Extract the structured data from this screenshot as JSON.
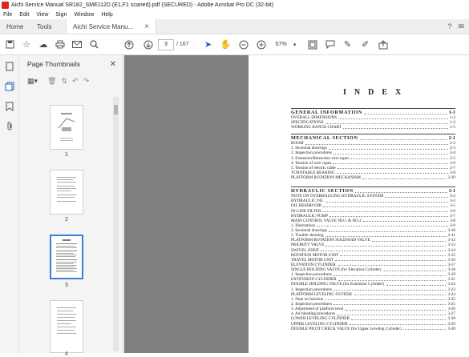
{
  "window": {
    "title": "Aichi Service Manual SR182_SME112D (E1,F1 scaned).pdf (SECURED) - Adobe Acrobat Pro DC (32-bit)"
  },
  "menu": [
    "File",
    "Edit",
    "View",
    "Sign",
    "Window",
    "Help"
  ],
  "tabs": {
    "home": "Home",
    "tools": "Tools",
    "document": "Aichi Service Manu...",
    "close": "×"
  },
  "toolbar": {
    "page_current": "3",
    "page_count": "/ 167",
    "zoom": "57%"
  },
  "thumbnails": {
    "title": "Page Thumbnails",
    "pages": [
      "1",
      "2",
      "3",
      "4"
    ],
    "selected": "3"
  },
  "document": {
    "index_title": "INDEX",
    "sections": [
      {
        "title": "GENERAL   INFORMATION",
        "page": "1-1",
        "items": [
          {
            "t": "OVERALL DIMENSIONS",
            "p": "1-2"
          },
          {
            "t": "SPECIFICATIONS",
            "p": "1-3"
          },
          {
            "t": "WORKING RANGE CHART",
            "p": "1-5"
          }
        ]
      },
      {
        "title": "MECHANICAL   SECTION",
        "page": "2-1",
        "items": [
          {
            "t": "BOOM",
            "p": "2-2"
          },
          {
            "t": "1. Sectional drawings",
            "p": "2-3"
          },
          {
            "t": "2. Inspection procedures",
            "p": "2-4"
          },
          {
            "t": "3. Extension/Retraction wire ropes",
            "p": "2-5"
          },
          {
            "t": "4. Tension of wire ropes",
            "p": "2-6"
          },
          {
            "t": "5. Tension of electric cable",
            "p": "2-7"
          },
          {
            "t": "TURNTABLE BEARING",
            "p": "2-8"
          },
          {
            "t": "PLATFORM ROTATION MECHANISM",
            "p": "2-10"
          }
        ]
      },
      {
        "title": "HYDRAULIC   SECTION",
        "page": "3-1",
        "items": [
          {
            "t": "NOTE ON OVERHAULING HYDRAULIC SYSTEM",
            "p": "3-2"
          },
          {
            "t": "HYDRAULIC OIL",
            "p": "3-3"
          },
          {
            "t": "OIL RESERVOIR",
            "p": "3-5"
          },
          {
            "t": "IN-LINE FILTER",
            "p": "3-6"
          },
          {
            "t": "HYDRAULIC PUMP",
            "p": "3-7"
          },
          {
            "t": "MAIN CONTROL VALVE NO.1 & NO.2",
            "p": "3-8"
          },
          {
            "t": "1. Illustrations",
            "p": "3-9"
          },
          {
            "t": "2. Sectional drawings",
            "p": "3-10"
          },
          {
            "t": "3. Trouble shooting",
            "p": "3-11"
          },
          {
            "t": "PLATFORM ROTATION SOLENOID VALVE",
            "p": "3-12"
          },
          {
            "t": "PRIORITY VALVE",
            "p": "3-13"
          },
          {
            "t": "SWIVEL JOINT",
            "p": "3-14"
          },
          {
            "t": "ROTATION MOTOR UNIT",
            "p": "3-15"
          },
          {
            "t": "TRAVEL MOTOR UNIT",
            "p": "3-16"
          },
          {
            "t": "ELEVATION CYLINDER",
            "p": "3-17"
          },
          {
            "t": "SINGLE HOLDING VALVE (for Elevation Cylinder)",
            "p": "3-18"
          },
          {
            "t": "1. Inspection procedures",
            "p": "3-19"
          },
          {
            "t": "EXTENSION CYLINDER",
            "p": "3-21"
          },
          {
            "t": "DOUBLE HOLDING VALVE (for Extension Cylinder)",
            "p": "3-22"
          },
          {
            "t": "1. Inspection procedures",
            "p": "3-23"
          },
          {
            "t": "PLATFORM LEVELING SYSTEM",
            "p": "3-24"
          },
          {
            "t": "1. Note on function",
            "p": "3-25"
          },
          {
            "t": "2. Inspection procedures",
            "p": "3-25"
          },
          {
            "t": "3. Adjustment of platform level",
            "p": "3-26"
          },
          {
            "t": "4. Air bleeding procedures",
            "p": "3-27"
          },
          {
            "t": "LOWER LEVELING CYLINDER",
            "p": "3-28"
          },
          {
            "t": "UPPER LEVELING CYLINDER",
            "p": "3-29"
          },
          {
            "t": "DOUBLE PILOT CHECK VALVE (for Upper Leveling Cylinder)",
            "p": "3-30"
          }
        ]
      }
    ]
  }
}
